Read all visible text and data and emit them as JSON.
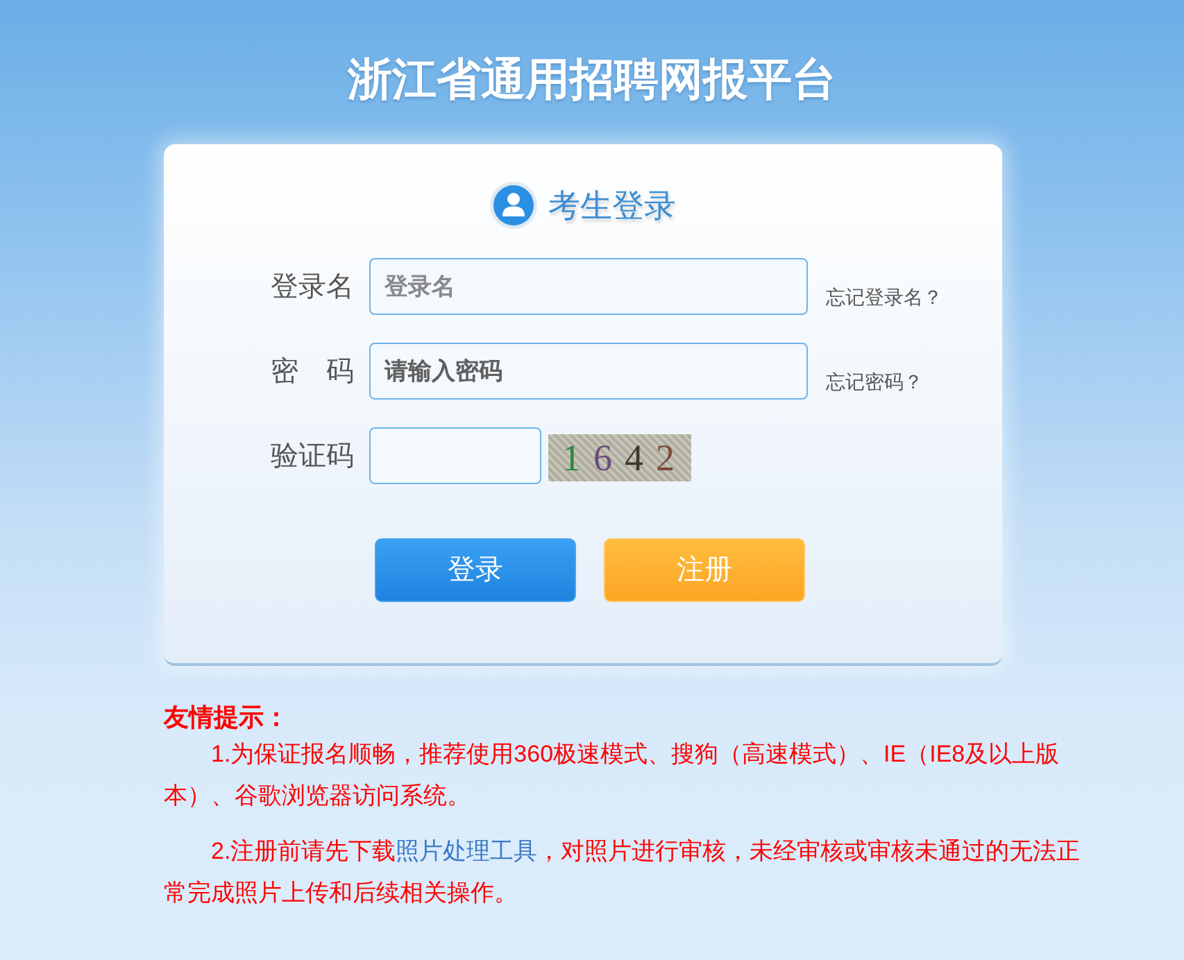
{
  "header": {
    "title": "浙江省通用招聘网报平台"
  },
  "login_card": {
    "heading": "考生登录",
    "fields": [
      {
        "kind": "text",
        "label": "登录名",
        "placeholder": "登录名",
        "link": "忘记登录名？"
      },
      {
        "kind": "password",
        "label": "密　码",
        "placeholder": "请输入密码",
        "link": "忘记密码？"
      },
      {
        "kind": "captcha",
        "label": "验证码",
        "captcha": "1642"
      }
    ],
    "buttons": [
      {
        "kind": "primary",
        "label": "登录"
      },
      {
        "kind": "secondary",
        "label": "注册"
      }
    ]
  },
  "notice": {
    "title": "友情提示：",
    "paragraphs": [
      {
        "segments": [
          {
            "kind": "text",
            "text": "1.为保证报名顺畅，推荐使用360极速模式、搜狗（高速模式）、IE（IE8及以上版本）、谷歌浏览器访问系统。"
          }
        ]
      },
      {
        "segments": [
          {
            "kind": "text",
            "text": "2.注册前请先下载"
          },
          {
            "kind": "link",
            "text": "照片处理工具"
          },
          {
            "kind": "text",
            "text": "，对照片进行审核，未经审核或审核未通过的无法正常完成照片上传和后续相关操作。"
          }
        ]
      }
    ]
  }
}
